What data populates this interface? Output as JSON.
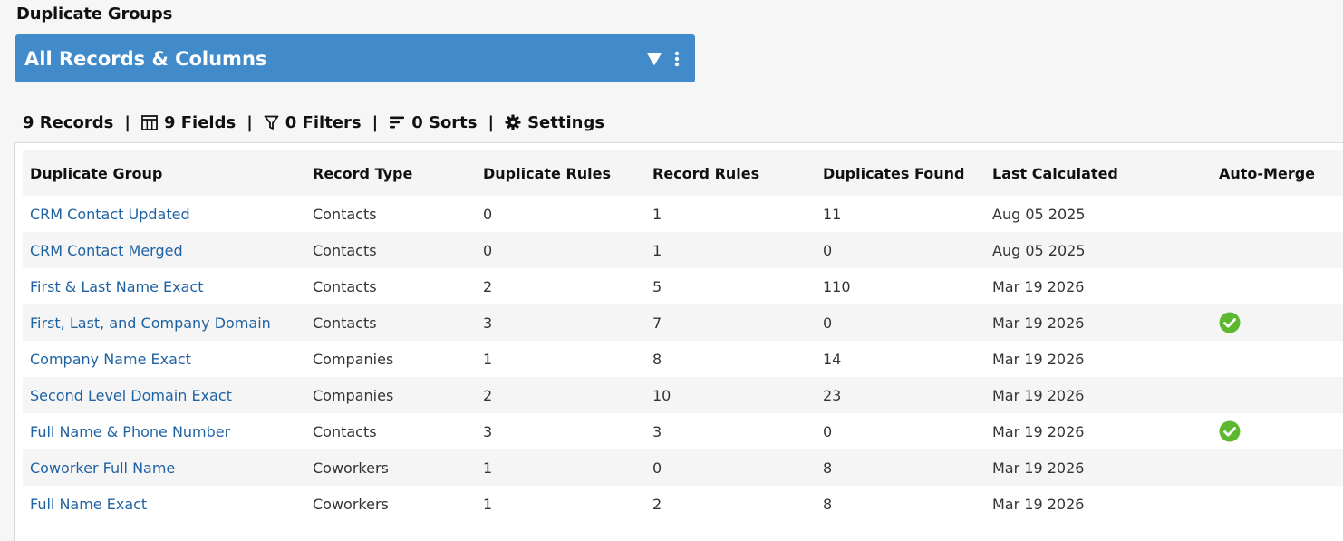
{
  "page": {
    "title": "Duplicate Groups"
  },
  "view": {
    "title": "All Records & Columns",
    "filter_icon": "filter-triangle-icon",
    "menu_icon": "kebab-menu-icon",
    "color": "#428bca"
  },
  "toolbar": {
    "records": "9 Records",
    "fields": "9 Fields",
    "filters": "0 Filters",
    "sorts": "0 Sorts",
    "settings": "Settings",
    "separator": "|"
  },
  "table": {
    "columns": [
      "Duplicate Group",
      "Record Type",
      "Duplicate Rules",
      "Record Rules",
      "Duplicates Found",
      "Last Calculated",
      "Auto-Merge"
    ],
    "rows": [
      {
        "name": "CRM Contact Updated",
        "record_type": "Contacts",
        "duplicate_rules": "0",
        "record_rules": "1",
        "duplicates_found": "11",
        "last_calculated": "Aug 05 2025",
        "auto_merge": false
      },
      {
        "name": "CRM Contact Merged",
        "record_type": "Contacts",
        "duplicate_rules": "0",
        "record_rules": "1",
        "duplicates_found": "0",
        "last_calculated": "Aug 05 2025",
        "auto_merge": false
      },
      {
        "name": "First & Last Name Exact",
        "record_type": "Contacts",
        "duplicate_rules": "2",
        "record_rules": "5",
        "duplicates_found": "110",
        "last_calculated": "Mar 19 2026",
        "auto_merge": false
      },
      {
        "name": "First, Last, and Company Domain",
        "record_type": "Contacts",
        "duplicate_rules": "3",
        "record_rules": "7",
        "duplicates_found": "0",
        "last_calculated": "Mar 19 2026",
        "auto_merge": true
      },
      {
        "name": "Company Name Exact",
        "record_type": "Companies",
        "duplicate_rules": "1",
        "record_rules": "8",
        "duplicates_found": "14",
        "last_calculated": "Mar 19 2026",
        "auto_merge": false
      },
      {
        "name": "Second Level Domain Exact",
        "record_type": "Companies",
        "duplicate_rules": "2",
        "record_rules": "10",
        "duplicates_found": "23",
        "last_calculated": "Mar 19 2026",
        "auto_merge": false
      },
      {
        "name": "Full Name & Phone Number",
        "record_type": "Contacts",
        "duplicate_rules": "3",
        "record_rules": "3",
        "duplicates_found": "0",
        "last_calculated": "Mar 19 2026",
        "auto_merge": true
      },
      {
        "name": "Coworker Full Name",
        "record_type": "Coworkers",
        "duplicate_rules": "1",
        "record_rules": "0",
        "duplicates_found": "8",
        "last_calculated": "Mar 19 2026",
        "auto_merge": false
      },
      {
        "name": "Full Name Exact",
        "record_type": "Coworkers",
        "duplicate_rules": "1",
        "record_rules": "2",
        "duplicates_found": "8",
        "last_calculated": "Mar 19 2026",
        "auto_merge": false
      }
    ],
    "check_icon": "check-circle-icon",
    "check_color": "#5cb82e",
    "link_color": "#1f62a3"
  }
}
